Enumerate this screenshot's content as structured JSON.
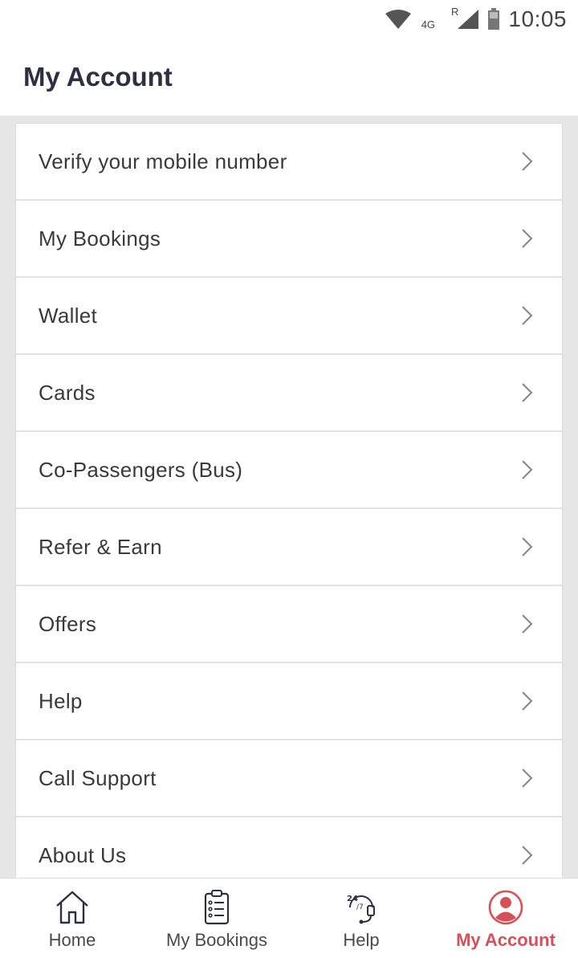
{
  "status_bar": {
    "network_label": "4G",
    "roaming_label": "R",
    "time": "10:05"
  },
  "header": {
    "title": "My Account"
  },
  "menu": {
    "items": [
      {
        "label": "Verify your mobile number"
      },
      {
        "label": "My Bookings"
      },
      {
        "label": "Wallet"
      },
      {
        "label": "Cards"
      },
      {
        "label": "Co-Passengers (Bus)"
      },
      {
        "label": "Refer & Earn"
      },
      {
        "label": "Offers"
      },
      {
        "label": "Help"
      },
      {
        "label": "Call Support"
      },
      {
        "label": "About Us"
      }
    ]
  },
  "bottom_nav": {
    "items": [
      {
        "label": "Home",
        "icon": "home-icon",
        "active": false
      },
      {
        "label": "My Bookings",
        "icon": "clipboard-icon",
        "active": false
      },
      {
        "label": "Help",
        "icon": "support-24-7-icon",
        "active": false
      },
      {
        "label": "My Account",
        "icon": "account-icon",
        "active": true
      }
    ]
  },
  "colors": {
    "accent": "#d84f57",
    "title": "#2f2f44",
    "content_background": "#e6e6e6"
  }
}
